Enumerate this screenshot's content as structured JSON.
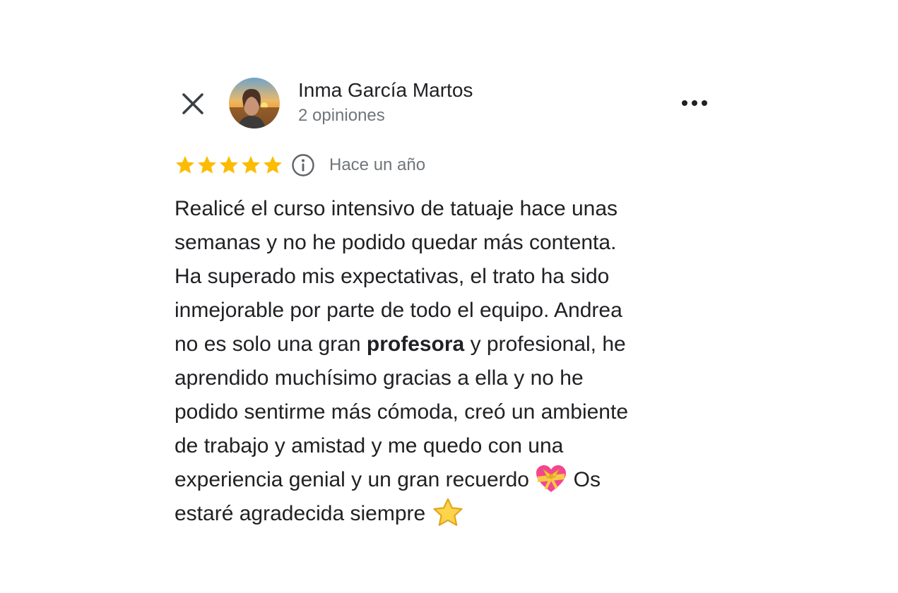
{
  "header": {
    "close_icon": "close-icon",
    "avatar_icon": "avatar-photo-sunset",
    "more_icon": "more-horizontal-icon"
  },
  "author": {
    "name": "Inma García Martos",
    "reviews_count": "2 opiniones"
  },
  "review": {
    "rating": 5,
    "max_rating": 5,
    "star_color": "#fbbc04",
    "date": "Hace un año",
    "lines": [
      "Realicé el curso intensivo de tatuaje hace unas",
      "semanas y no he podido quedar más contenta.",
      "Ha superado mis expectativas, el trato ha sido",
      "inmejorable por parte de todo el equipo. Andrea"
    ],
    "line5": {
      "before": "no es solo una gran ",
      "bold": "profesora",
      "after": " y profesional, he"
    },
    "lines_b": [
      "aprendido muchísimo gracias a ella y no he",
      "podido sentirme más cómoda, creó un ambiente",
      "de trabajo y amistad y me quedo con una"
    ],
    "line9": {
      "before": "experiencia genial y un gran recuerdo ",
      "emoji": "heart-with-ribbon-emoji",
      "after": " Os"
    },
    "line10": {
      "before": "estaré agradecida siempre ",
      "emoji": "star-emoji"
    }
  }
}
